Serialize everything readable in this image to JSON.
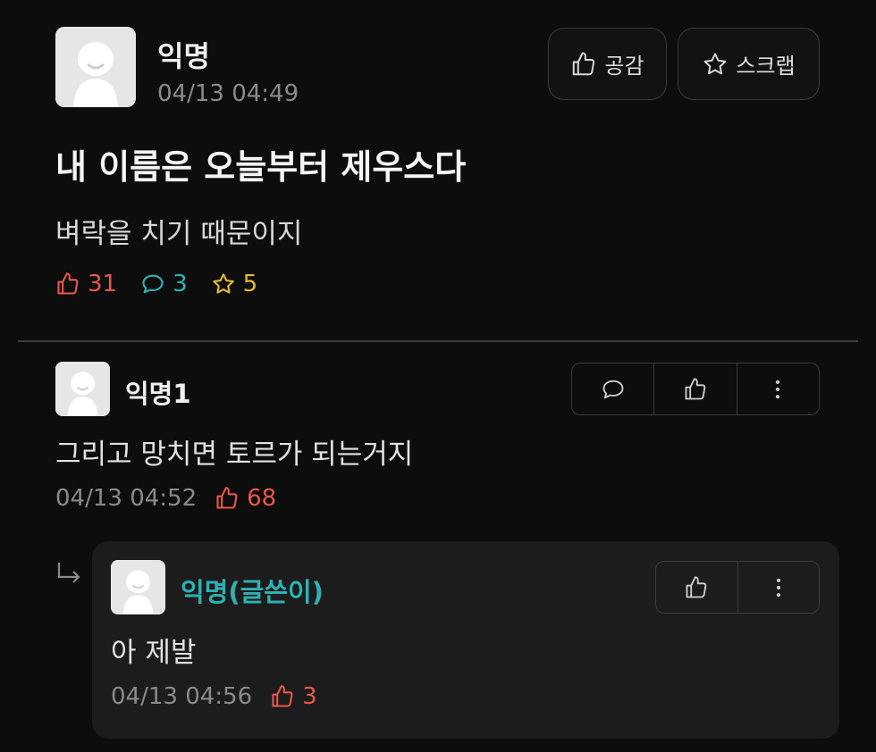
{
  "post": {
    "author": "익명",
    "time": "04/13 04:49",
    "like_button": "공감",
    "scrap_button": "스크랩",
    "title": "내 이름은 오늘부터 제우스다",
    "body": "벼락을 치기 때문이지",
    "stats": {
      "likes": "31",
      "comments": "3",
      "scraps": "5"
    }
  },
  "comments": [
    {
      "author": "익명1",
      "text": "그리고 망치면 토르가 되는거지",
      "time": "04/13 04:52",
      "likes": "68"
    }
  ],
  "replies": [
    {
      "author": "익명(글쓴이)",
      "text": "아 제발",
      "time": "04/13 04:56",
      "likes": "3"
    }
  ],
  "colors": {
    "background": "#0d0d0d",
    "like": "#e8574c",
    "comment": "#2fb1b4",
    "scrap": "#e2bd2a",
    "op_name": "#2fb1b4",
    "reply_card": "#1c1c1c"
  },
  "icons": [
    "thumbs-up-icon",
    "star-icon",
    "comment-bubble-icon",
    "more-vertical-icon",
    "reply-arrow-icon",
    "avatar-icon"
  ]
}
